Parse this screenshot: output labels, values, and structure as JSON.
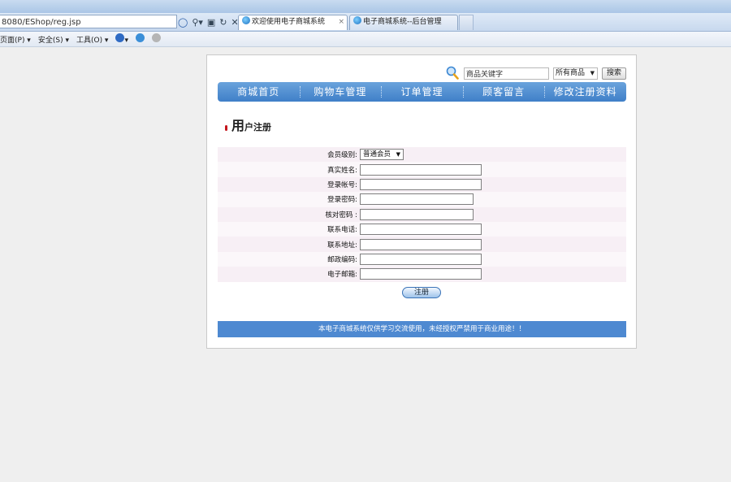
{
  "browser": {
    "address": "8080/EShop/reg.jsp",
    "tabs": [
      {
        "label": "欢迎使用电子商城系统"
      },
      {
        "label": "电子商城系统--后台管理"
      }
    ],
    "commands": {
      "page": "页面(P) ▾",
      "safety": "安全(S) ▾",
      "tools": "工具(O) ▾"
    }
  },
  "search": {
    "placeholder": "商品关键字",
    "category": "所有商品",
    "button": "搜索"
  },
  "nav": {
    "items": [
      "商城首页",
      "购物车管理",
      "订单管理",
      "顾客留言",
      "修改注册资料"
    ]
  },
  "section": {
    "title_big": "用",
    "title_small": "户注册"
  },
  "form": {
    "member_level_label": "会员级别:",
    "member_level_value": "普通会员",
    "real_name_label": "真实姓名:",
    "account_label": "登录帐号:",
    "password_label": "登录密码:",
    "confirm_password_label": "核对密码 :",
    "phone_label": "联系电话:",
    "address_label": "联系地址:",
    "postcode_label": "邮政编码:",
    "email_label": "电子邮箱:",
    "submit_label": "注册"
  },
  "footer": {
    "text": "本电子商城系统仅供学习交流使用，未经授权严禁用于商业用途！！"
  }
}
